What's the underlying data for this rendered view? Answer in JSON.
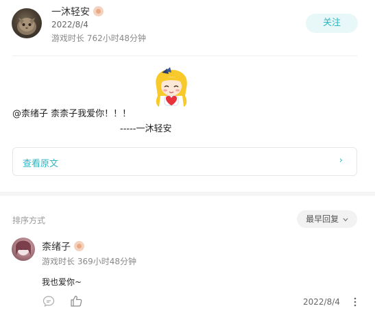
{
  "post": {
    "author_name": "一沐轻安",
    "date": "2022/8/4",
    "play_time": "游戏时长 762小时48分钟",
    "follow_label": "关注",
    "body_line1": "@柰绪子 柰柰子我爱你！！！",
    "body_line2": "-----一沐轻安",
    "view_original_label": "查看原文",
    "chevron_glyph": "›"
  },
  "comments": {
    "sort_label": "排序方式",
    "sort_value": "最早回复",
    "items": [
      {
        "author_name": "柰绪子",
        "play_time": "游戏时长 369小时48分钟",
        "text": "我也爱你~",
        "date": "2022/8/4"
      }
    ]
  },
  "icons": {
    "badge": "level-badge-icon",
    "sticker": "anime-girl-heart-sticker",
    "comment": "comment-bubble-icon",
    "like": "thumbs-up-icon",
    "more": "more-vertical-icon",
    "chevron": "chevron-right-icon",
    "sort_chevron": "chevron-down-icon"
  },
  "colors": {
    "accent": "#2bb6c2",
    "follow_bg": "#e8f7f8",
    "divider": "#eeeeee",
    "section_gap": "#f5f5f5"
  }
}
